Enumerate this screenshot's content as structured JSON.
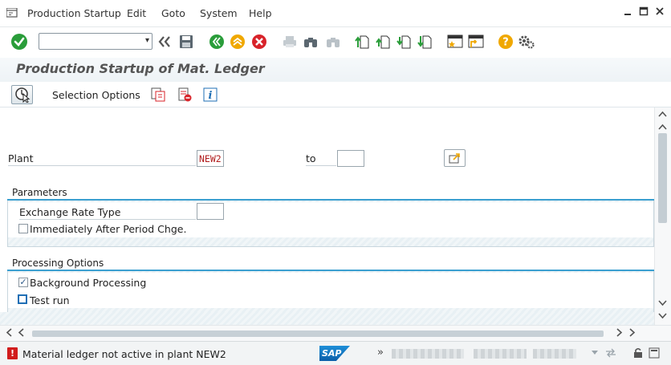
{
  "menubar": {
    "items": [
      {
        "label": "Production Startup",
        "ul": "P"
      },
      {
        "label": "Edit",
        "ul": "E"
      },
      {
        "label": "Goto",
        "ul": "G"
      },
      {
        "label": "System",
        "ul": "S"
      },
      {
        "label": "Help",
        "ul": "H"
      }
    ],
    "window_controls": [
      "minimize-icon",
      "maximize-icon",
      "close-icon"
    ]
  },
  "toolbar": {
    "command_field": {
      "value": "",
      "placeholder": ""
    },
    "icons": [
      "enter-icon",
      "back-double-icon",
      "save-icon",
      "back-icon",
      "exit-icon",
      "cancel-icon",
      "print-icon",
      "find-icon",
      "find-next-icon",
      "first-page-icon",
      "previous-page-icon",
      "next-page-icon",
      "last-page-icon",
      "create-session-icon",
      "create-shortcut-icon",
      "help-icon",
      "customize-layout-icon"
    ]
  },
  "title": {
    "text": "Production Startup of Mat. Ledger"
  },
  "app_toolbar": {
    "selection_options": "Selection Options",
    "icons": [
      "execute-icon",
      "get-variant-icon",
      "delete-variant-icon",
      "info-icon"
    ]
  },
  "form": {
    "plant": {
      "label": "Plant",
      "value": "NEW2",
      "to_label": "to",
      "to_value": ""
    },
    "parameters": {
      "title": "Parameters",
      "exchange_rate_type": {
        "label": "Exchange Rate Type",
        "value": ""
      },
      "immediately_after_period": {
        "label": "Immediately After Period Chge.",
        "checked": false
      }
    },
    "processing_options": {
      "title": "Processing Options",
      "background_processing": {
        "label": "Background Processing",
        "checked": true,
        "mark": "✓"
      },
      "test_run": {
        "label": "Test run",
        "checked": false
      }
    }
  },
  "statusbar": {
    "message": "Material ledger not active in plant NEW2",
    "message_type": "error",
    "error_mark": "!",
    "logo": "SAP",
    "expand": "»"
  },
  "colors": {
    "accent": "#3b9fd0",
    "error": "#d11c1c",
    "ok_green": "#2a9d3a",
    "title_gray": "#555555"
  }
}
